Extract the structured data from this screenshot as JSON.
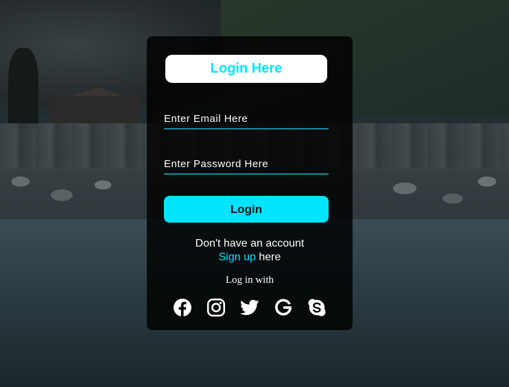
{
  "form": {
    "title": "Login Here",
    "email_placeholder": "Enter Email Here",
    "password_placeholder": "Enter Password Here",
    "login_label": "Login",
    "no_account_text": "Don't have an account",
    "signup_link": "Sign up",
    "signup_suffix": " here",
    "login_with": "Log in with"
  },
  "socials": [
    {
      "icon": "facebook-icon"
    },
    {
      "icon": "instagram-icon"
    },
    {
      "icon": "twitter-icon"
    },
    {
      "icon": "google-icon"
    },
    {
      "icon": "skype-icon"
    }
  ],
  "colors": {
    "accent": "#00e5ff",
    "card_background": "#000000",
    "underline": "#0e8ea0"
  }
}
